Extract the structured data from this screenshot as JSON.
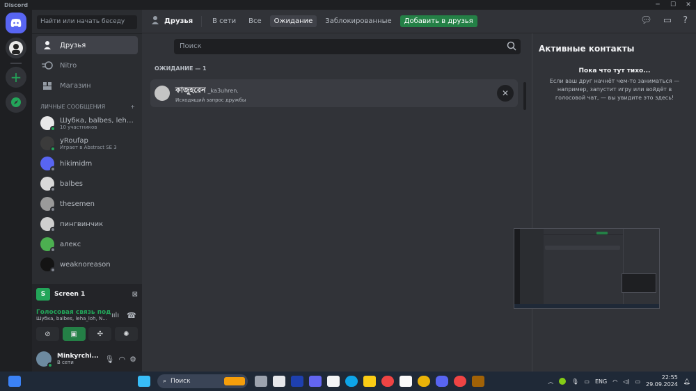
{
  "window": {
    "title": "Discord"
  },
  "sidebar": {
    "search_placeholder": "Найти или начать беседу",
    "nav": [
      {
        "label": "Друзья"
      },
      {
        "label": "Nitro"
      },
      {
        "label": "Магазин"
      }
    ],
    "dm_header": "ЛИЧНЫЕ СООБЩЕНИЯ",
    "dms": [
      {
        "name": "Шубка, balbes, leha_l...",
        "sub": "10 участников",
        "status": "online"
      },
      {
        "name": "yRoufap",
        "sub": "Играет в Abstract SE 3",
        "status": "online"
      },
      {
        "name": "hikimidm",
        "sub": "",
        "status": "offline"
      },
      {
        "name": "balbes",
        "sub": "",
        "status": "offline"
      },
      {
        "name": "thesemen",
        "sub": "",
        "status": "offline"
      },
      {
        "name": "пингвинчик",
        "sub": "",
        "status": "offline"
      },
      {
        "name": "алекс",
        "sub": "",
        "status": "offline"
      },
      {
        "name": "weaknoreason",
        "sub": "",
        "status": "offline"
      }
    ],
    "stream": {
      "screen_label": "Screen 1",
      "voice_title": "Голосовая связь под",
      "voice_sub": "Шубка, balbes, leha_loh, N..."
    },
    "user": {
      "name": "Minkyrchi...",
      "status": "В сети"
    }
  },
  "header": {
    "title": "Друзья",
    "tabs": [
      {
        "label": "В сети",
        "active": false
      },
      {
        "label": "Все",
        "active": false
      },
      {
        "label": "Ожидание",
        "active": true
      },
      {
        "label": "Заблокированные",
        "active": false
      }
    ],
    "add_friend": "Добавить в друзья"
  },
  "main": {
    "search_placeholder": "Поиск",
    "pending_header": "ОЖИДАНИЕ — 1",
    "pending": [
      {
        "display": "কাজুহরেন",
        "username": "_ka3uhren.",
        "sub": "Исходящий запрос дружбы"
      }
    ]
  },
  "active_now": {
    "title": "Активные контакты",
    "empty_title": "Пока что тут тихо...",
    "empty_text": "Если ваш друг начнёт чем-то заниматься — например, запустит игру или войдёт в голосовой чат, — вы увидите это здесь!"
  },
  "taskbar": {
    "search": "Поиск",
    "lang": "ENG",
    "time": "22:55",
    "date": "29.09.2024"
  },
  "colors": {
    "accent": "#5865f2",
    "green": "#23a559",
    "bg": "#313338",
    "sidebar": "#2b2d31"
  }
}
